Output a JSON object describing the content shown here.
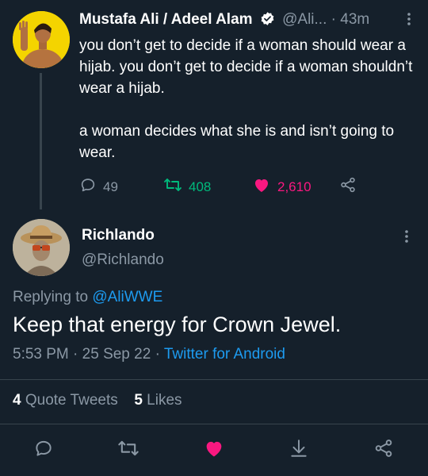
{
  "original_tweet": {
    "name": "Mustafa Ali / Adeel Alam",
    "handle": "@Ali...",
    "time": "· 43m",
    "body_lines": [
      "you don’t get to decide if a woman should wear a hijab. you don’t get to decide if a woman shouldn’t wear a hijab.",
      "a woman decides what she is and isn’t going to wear."
    ],
    "replies": "49",
    "retweets": "408",
    "likes": "2,610"
  },
  "reply_tweet": {
    "name": "Richlando",
    "handle": "@Richlando",
    "replying_prefix": "Replying to",
    "replying_to": "@AliWWE",
    "text": "Keep that energy for Crown Jewel.",
    "time": "5:53 PM",
    "date": "25 Sep 22",
    "source": "Twitter for Android",
    "quote_tweets_count": "4",
    "quote_tweets_label": "Quote Tweets",
    "likes_count": "5",
    "likes_label": "Likes"
  },
  "colors": {
    "background": "#15202b",
    "muted": "#8b98a5",
    "link": "#1d9bf0",
    "retweet": "#00ba7c",
    "like": "#f91880"
  },
  "icons": [
    "verified-badge-icon",
    "more-options-icon",
    "reply-icon",
    "retweet-icon",
    "heart-icon",
    "share-icon",
    "bookmark-download-icon"
  ]
}
